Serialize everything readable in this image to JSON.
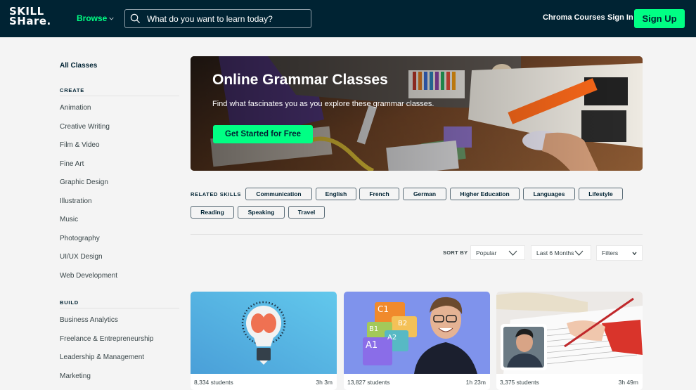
{
  "header": {
    "logo_line1": "SKILL",
    "logo_line2": "SHare.",
    "browse_label": "Browse",
    "search_placeholder": "What do you want to learn today?",
    "chroma_courses_label": "Chroma Courses",
    "sign_in_label": "Sign In",
    "sign_up_label": "Sign Up"
  },
  "sidebar": {
    "all_classes": "All Classes",
    "sections": [
      {
        "title": "CREATE",
        "items": [
          "Animation",
          "Creative Writing",
          "Film & Video",
          "Fine Art",
          "Graphic Design",
          "Illustration",
          "Music",
          "Photography",
          "UI/UX Design",
          "Web Development"
        ]
      },
      {
        "title": "BUILD",
        "items": [
          "Business Analytics",
          "Freelance & Entrepreneurship",
          "Leadership & Management",
          "Marketing"
        ]
      }
    ]
  },
  "hero": {
    "title": "Online Grammar Classes",
    "subtitle": "Find what fascinates you as you explore these grammar classes.",
    "cta_label": "Get Started for Free"
  },
  "related_skills": {
    "label": "RELATED SKILLS",
    "chips": [
      "Communication",
      "English",
      "French",
      "German",
      "Higher Education",
      "Languages",
      "Lifestyle",
      "Reading",
      "Speaking",
      "Travel"
    ]
  },
  "sort": {
    "label": "SORT BY",
    "sort_value": "Popular",
    "period_value": "Last 6 Months",
    "filters_label": "Filters"
  },
  "cards": [
    {
      "students": "8,334 students",
      "duration": "3h 3m",
      "thumb": "lightbulb-brain"
    },
    {
      "students": "13,827 students",
      "duration": "1h 23m",
      "thumb": "language-levels-teacher"
    },
    {
      "students": "3,375 students",
      "duration": "3h 49m",
      "thumb": "proofreading-hand"
    }
  ],
  "colors": {
    "brand_dark": "#002333",
    "brand_green": "#00ff84",
    "page_bg": "#f4f4f4"
  }
}
